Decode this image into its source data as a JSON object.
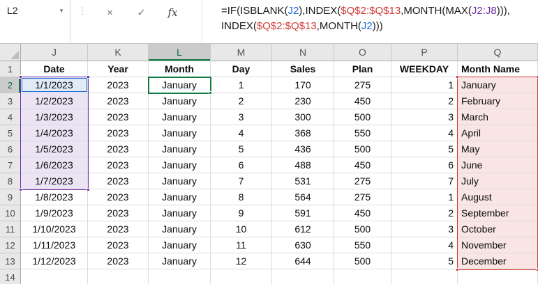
{
  "name_box": {
    "value": "L2"
  },
  "icons": {
    "dropdown": "▼",
    "drag_dots": "⋮"
  },
  "formula_bar": {
    "buttons": {
      "cancel": "×",
      "enter": "✓",
      "fx": "fx"
    },
    "lines": [
      [
        {
          "text": "=IF(ISBLANK(",
          "color": "text"
        },
        {
          "text": "J2",
          "color": "blue"
        },
        {
          "text": "),INDEX(",
          "color": "text"
        },
        {
          "text": "$Q$2:$Q$13",
          "color": "red"
        },
        {
          "text": ",MONTH(MAX(",
          "color": "text"
        },
        {
          "text": "J2:J8",
          "color": "purple"
        },
        {
          "text": "))),",
          "color": "text"
        }
      ],
      [
        {
          "text": "INDEX(",
          "color": "text"
        },
        {
          "text": "$Q$2:$Q$13",
          "color": "red"
        },
        {
          "text": ",MONTH(",
          "color": "text"
        },
        {
          "text": "J2",
          "color": "blue"
        },
        {
          "text": ")))",
          "color": "text"
        }
      ]
    ]
  },
  "colors": {
    "text": "#1a1a1a",
    "blue": "#2169D8",
    "red": "#D03A34",
    "purple": "#7030A0",
    "green": "#107C41"
  },
  "grid": {
    "column_letters": [
      "J",
      "K",
      "L",
      "M",
      "N",
      "O",
      "P",
      "Q"
    ],
    "active_column": "L",
    "active_row": "2",
    "active_cell": "L2",
    "field_headers": [
      "Date",
      "Year",
      "Month",
      "Day",
      "Sales",
      "Plan",
      "WEEKDAY",
      "Month Name"
    ],
    "rows": [
      [
        "1/1/2023",
        "2023",
        "January",
        "1",
        "170",
        "275",
        "1",
        "January"
      ],
      [
        "1/2/2023",
        "2023",
        "January",
        "2",
        "230",
        "450",
        "2",
        "February"
      ],
      [
        "1/3/2023",
        "2023",
        "January",
        "3",
        "300",
        "500",
        "3",
        "March"
      ],
      [
        "1/4/2023",
        "2023",
        "January",
        "4",
        "368",
        "550",
        "4",
        "April"
      ],
      [
        "1/5/2023",
        "2023",
        "January",
        "5",
        "436",
        "500",
        "5",
        "May"
      ],
      [
        "1/6/2023",
        "2023",
        "January",
        "6",
        "488",
        "450",
        "6",
        "June"
      ],
      [
        "1/7/2023",
        "2023",
        "January",
        "7",
        "531",
        "275",
        "7",
        "July"
      ],
      [
        "1/8/2023",
        "2023",
        "January",
        "8",
        "564",
        "275",
        "1",
        "August"
      ],
      [
        "1/9/2023",
        "2023",
        "January",
        "9",
        "591",
        "450",
        "2",
        "September"
      ],
      [
        "1/10/2023",
        "2023",
        "January",
        "10",
        "612",
        "500",
        "3",
        "October"
      ],
      [
        "1/11/2023",
        "2023",
        "January",
        "11",
        "630",
        "550",
        "4",
        "November"
      ],
      [
        "1/12/2023",
        "2023",
        "January",
        "12",
        "644",
        "500",
        "5",
        "December"
      ]
    ],
    "highlighted_ranges": {
      "blue": "J2",
      "purple": "J2:J8",
      "red": "Q2:Q13",
      "selection": "L2"
    }
  }
}
